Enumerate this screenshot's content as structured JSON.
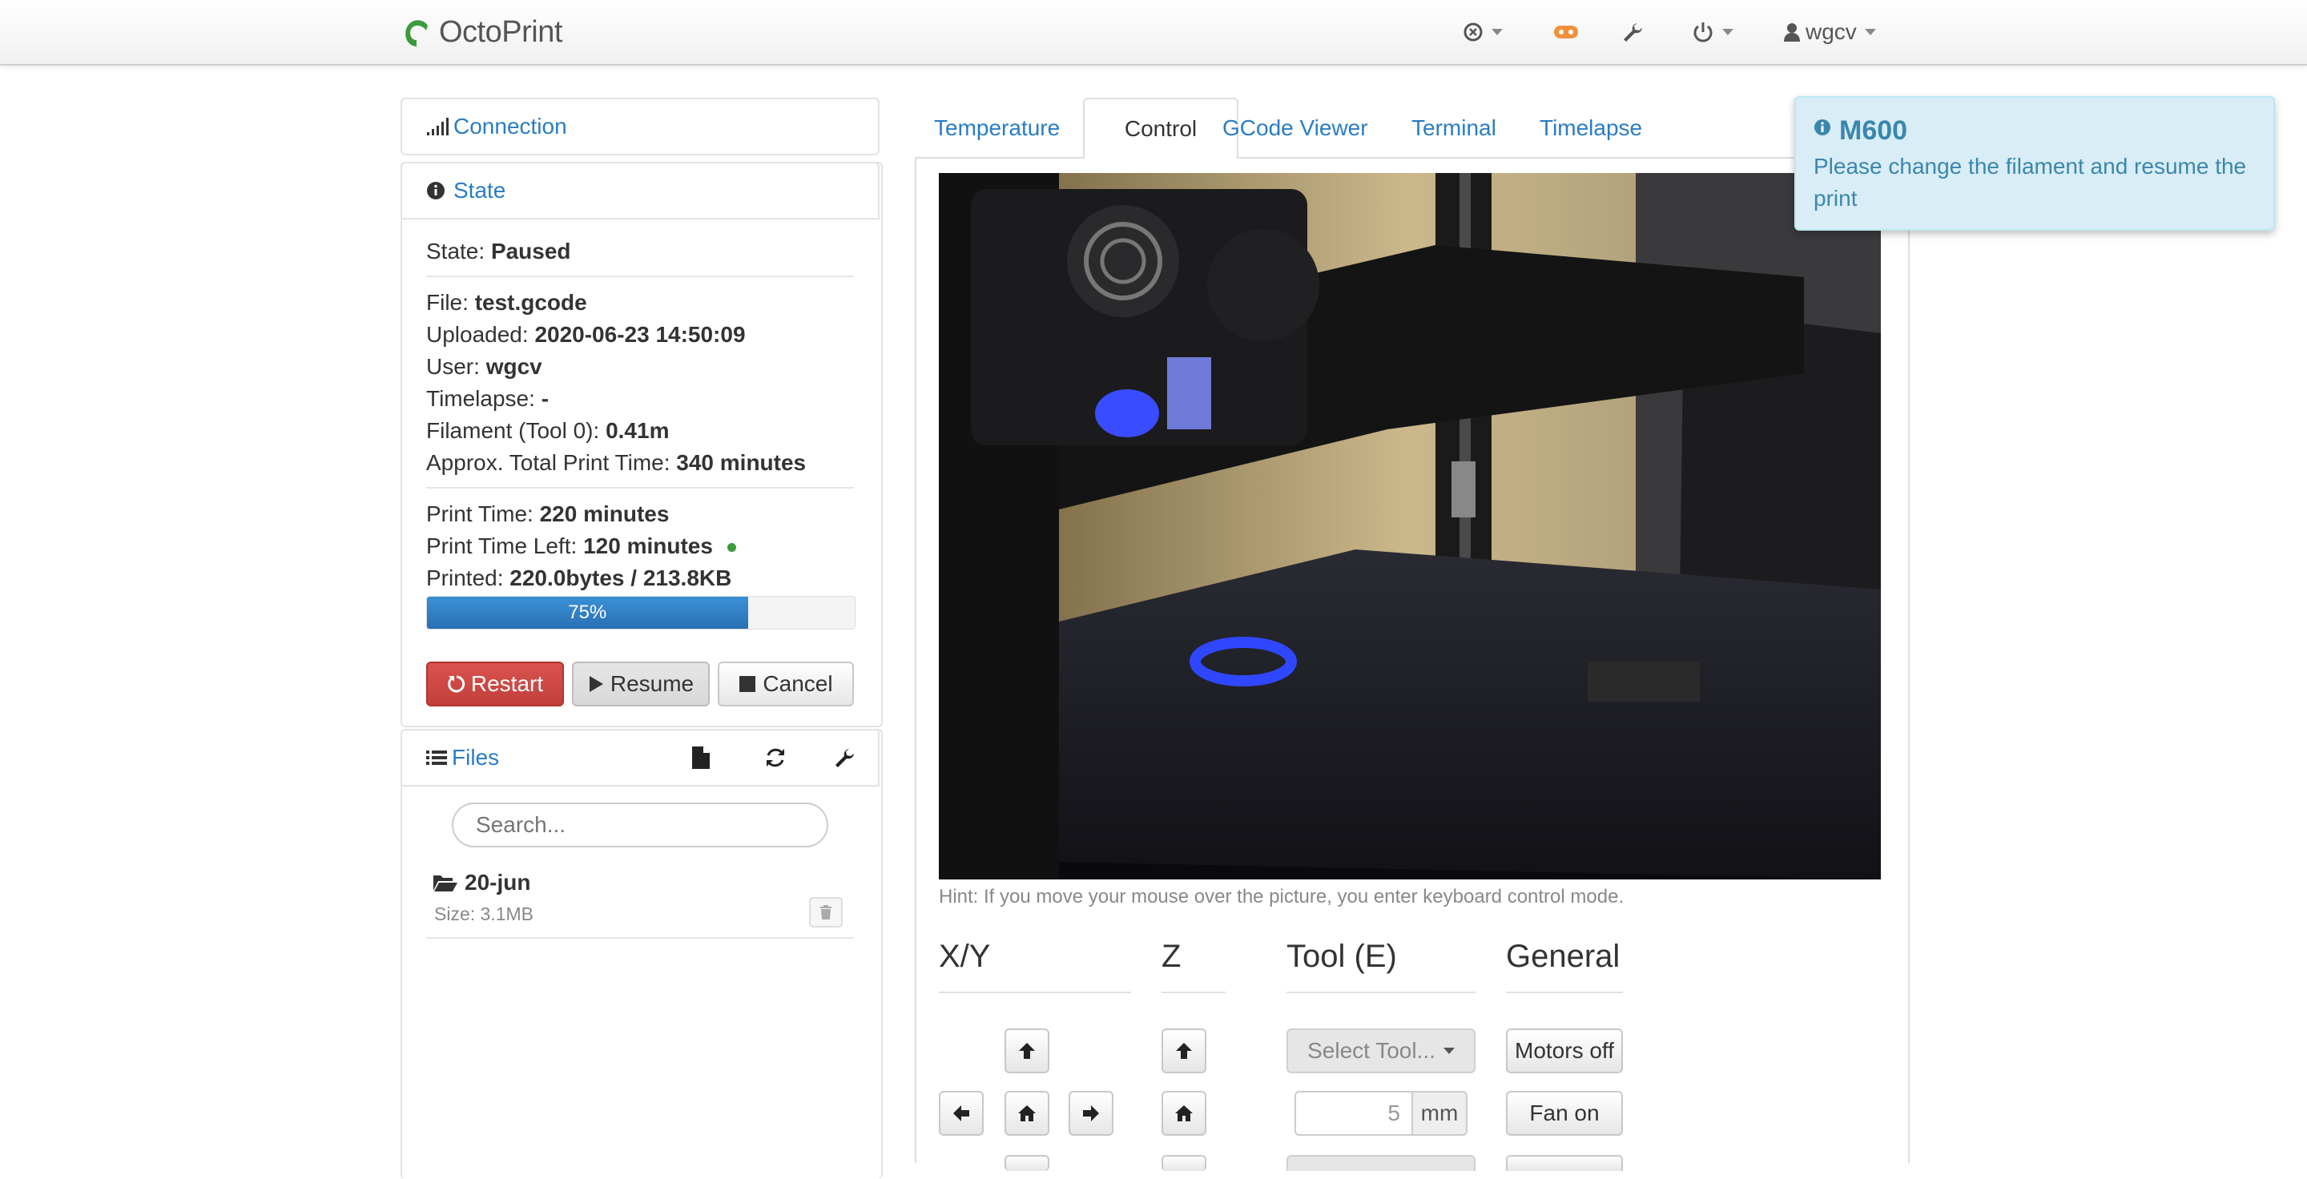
{
  "navbar": {
    "brand": "OctoPrint",
    "user": "wgcv"
  },
  "sidebar": {
    "connection": {
      "title": "Connection"
    },
    "state": {
      "title": "State",
      "state_label": "State: ",
      "state_value": "Paused",
      "file_label": "File: ",
      "file_value": "test.gcode",
      "uploaded_label": "Uploaded: ",
      "uploaded_value": "2020-06-23 14:50:09",
      "user_label": "User: ",
      "user_value": "wgcv",
      "timelapse_label": "Timelapse: ",
      "timelapse_value": "-",
      "filament_label": "Filament (Tool 0): ",
      "filament_value": "0.41m",
      "approx_label": "Approx. Total Print Time: ",
      "approx_value": "340 minutes",
      "print_time_label": "Print Time: ",
      "print_time_value": "220 minutes",
      "time_left_label": "Print Time Left: ",
      "time_left_value": "120 minutes",
      "printed_label": "Printed: ",
      "printed_value": "220.0bytes / 213.8KB",
      "progress_text": "75%",
      "progress": 0.75,
      "buttons": {
        "restart": "Restart",
        "resume": "Resume",
        "cancel": "Cancel"
      }
    },
    "files": {
      "title": "Files",
      "search_placeholder": "Search...",
      "items": [
        {
          "name": "20-jun",
          "size": "Size: 3.1MB"
        }
      ]
    }
  },
  "tabs": [
    {
      "label": "Temperature"
    },
    {
      "label": "Control"
    },
    {
      "label": "GCode Viewer"
    },
    {
      "label": "Terminal"
    },
    {
      "label": "Timelapse"
    }
  ],
  "control": {
    "hint": "Hint: If you move your mouse over the picture, you enter keyboard control mode.",
    "sections": {
      "xy": "X/Y",
      "z": "Z",
      "tool": "Tool (E)",
      "general": "General"
    },
    "select_tool": "Select Tool...",
    "extrude_amount": "5",
    "extrude_unit": "mm",
    "motors_off": "Motors off",
    "fan_on": "Fan on"
  },
  "notification": {
    "title": "M600",
    "message": "Please change the filament and resume the print"
  },
  "colors": {
    "accent": "#2a7cc4",
    "danger": "#d9534f",
    "notify_bg": "#d9edf7",
    "status_dot": "#3c9a3c"
  }
}
